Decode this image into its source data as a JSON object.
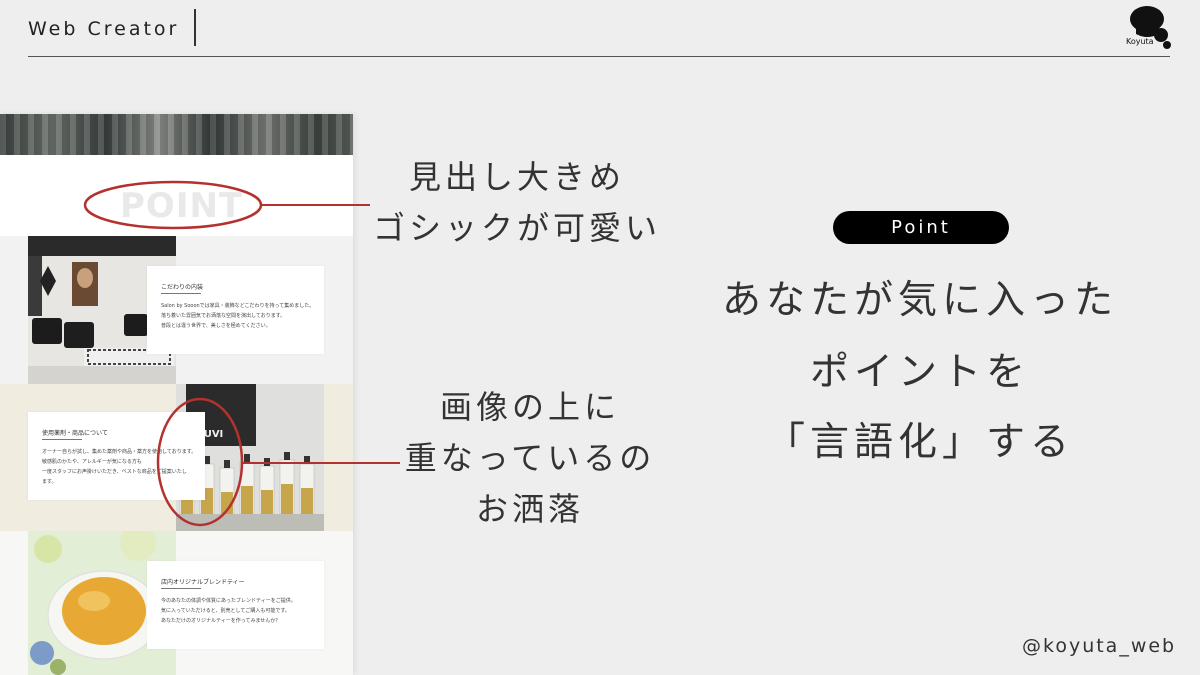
{
  "header": {
    "brand": "Web Creator",
    "logo_text": "Koyuta",
    "logo_icon": "koyuta-avatar-icon"
  },
  "mockup": {
    "point_word": "POINT",
    "sections": [
      {
        "title": "こだわりの内装",
        "lines": [
          "Salon by Sooonでは家具・装飾などこだわりを持って集めました。",
          "落ち着いた雰囲気でお洒落な空間を演出しております。",
          "普段とは違う世界で、美しさを極めてください。"
        ]
      },
      {
        "title": "使用薬剤・商品について",
        "lines": [
          "オーナー自らが試し、集めた薬剤や商品・薬方を使用しております。",
          "敏感肌のかたや、アレルギーが気になる方も",
          "一度スタッフにお声掛けいただき、ベストな商品をご提案いたし",
          "ます。"
        ],
        "photo_label": "RUVI"
      },
      {
        "title": "店内オリジナルブレンドティー",
        "lines": [
          "今のあなたの体調や体質にあったブレンドティーをご提供。",
          "気に入っていただけると、別売としてご購入も可能です。",
          "あなただけのオリジナルティーを作ってみませんか？"
        ]
      }
    ]
  },
  "annotations": {
    "heading": [
      "見出し大きめ",
      "ゴシックが可愛い"
    ],
    "overlap": [
      "画像の上に",
      "重なっているの",
      "お洒落"
    ]
  },
  "message": {
    "pill": "Point",
    "lines": [
      "あなたが気に入った",
      "ポイントを",
      "「言語化」する"
    ]
  },
  "footer": {
    "handle": "@koyuta_web"
  },
  "colors": {
    "background": "#eeeeee",
    "accent_red": "#b3322f",
    "pill_bg": "#000000"
  }
}
